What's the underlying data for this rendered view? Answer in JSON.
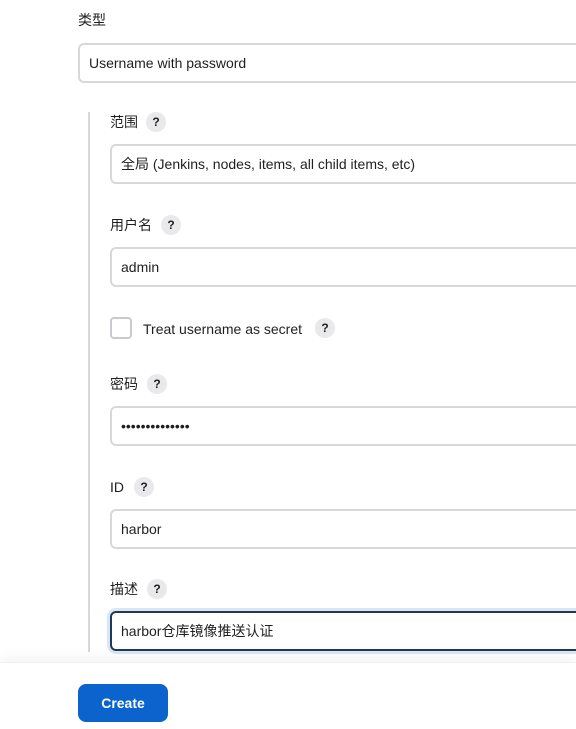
{
  "kind": {
    "label": "类型",
    "value": "Username with password"
  },
  "scope": {
    "label": "范围",
    "help": "?",
    "value": "全局 (Jenkins, nodes, items, all child items, etc)"
  },
  "username": {
    "label": "用户名",
    "help": "?",
    "value": "admin"
  },
  "treat_secret": {
    "label": "Treat username as secret",
    "help": "?",
    "checked": false
  },
  "password": {
    "label": "密码",
    "help": "?",
    "masked_value": "••••••••••••••"
  },
  "id": {
    "label": "ID",
    "help": "?",
    "value": "harbor"
  },
  "description": {
    "label": "描述",
    "help": "?",
    "value": "harbor仓库镜像推送认证"
  },
  "actions": {
    "create_label": "Create"
  },
  "colors": {
    "primary_button": "#0b63ce",
    "input_border": "#d7d8dc",
    "focus_border": "#1d3b57"
  }
}
